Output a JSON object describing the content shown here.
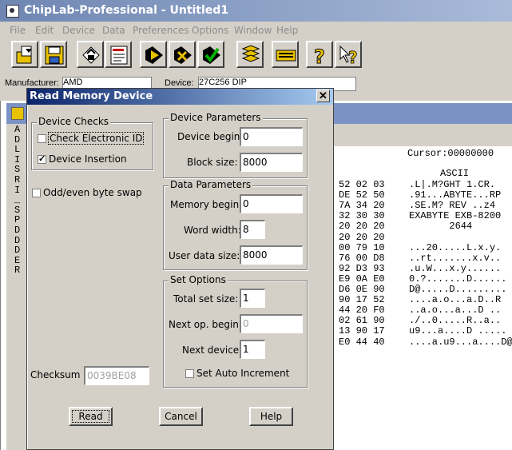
{
  "app": {
    "title": "ChipLab-Professional - Untitled1"
  },
  "menu": [
    "File",
    "Edit",
    "Device",
    "Data",
    "Preferences",
    "Options",
    "Window",
    "Help"
  ],
  "toolbar": {
    "buttons": [
      "open-icon",
      "save-icon",
      "read-device-icon",
      "note-icon",
      "program-icon",
      "verify-icon",
      "blank-check-icon",
      "layers-icon",
      "keyboard-icon",
      "help-icon",
      "context-help-icon"
    ]
  },
  "device_bar": {
    "manufacturer_label": "Manufacturer:",
    "manufacturer_value": "AMD",
    "device_label": "Device:",
    "device_value": "27C256 DIP"
  },
  "child": {
    "left_letters": [
      "A",
      "D",
      "L",
      "I",
      "S",
      "R",
      "I",
      "_",
      "S",
      "P",
      "D",
      "D",
      "D",
      "E",
      "R"
    ],
    "cursor_label": "Cursor:00000000",
    "ascii_header": "ASCII",
    "hex_rows": [
      {
        "hex": "52 02 03",
        "ascii": ".L|.M?GHT 1.CR."
      },
      {
        "hex": "DE 52 50",
        "ascii": ".91...ABYTE...RP"
      },
      {
        "hex": "7A 34 20",
        "ascii": ".SE.M? REV ..z4"
      },
      {
        "hex": "32 30 30",
        "ascii": "EXABYTE EXB-8200"
      },
      {
        "hex": "20 20 20",
        "ascii": "       2644"
      },
      {
        "hex": "20 20 20",
        "ascii": ""
      },
      {
        "hex": "00 79 10",
        "ascii": "...20.....L.x.y."
      },
      {
        "hex": "76 00 D8",
        "ascii": "..rt.......x.v.."
      },
      {
        "hex": "92 D3 93",
        "ascii": ".u.W...x.y......"
      },
      {
        "hex": "E9 0A E0",
        "ascii": "0.?.......D......"
      },
      {
        "hex": "D6 0E 90",
        "ascii": "D@.....D........."
      },
      {
        "hex": "90 17 52",
        "ascii": "....a.o...a.D..R"
      },
      {
        "hex": "44 20 F0",
        "ascii": "..a.o...a...D .."
      },
      {
        "hex": "02 61 90",
        "ascii": "./..0.....R..a.."
      },
      {
        "hex": "13 90 17",
        "ascii": "u9...a....D ....."
      },
      {
        "hex": "E0 44 40",
        "ascii": "....a.u9...a....D@"
      }
    ]
  },
  "dialog": {
    "title": "Read Memory Device",
    "device_checks": {
      "title": "Device Checks",
      "check_electronic_id": {
        "label": "Check Electronic ID",
        "checked": false
      },
      "device_insertion": {
        "label": "Device Insertion",
        "checked": true
      }
    },
    "odd_even_swap": {
      "label": "Odd/even byte swap",
      "checked": false
    },
    "device_parameters": {
      "title": "Device Parameters",
      "device_begin_label": "Device begin:",
      "device_begin": "0",
      "block_size_label": "Block size:",
      "block_size": "8000"
    },
    "data_parameters": {
      "title": "Data Parameters",
      "memory_begin_label": "Memory begin:",
      "memory_begin": "0",
      "word_width_label": "Word width:",
      "word_width": "8",
      "user_data_size_label": "User data size:",
      "user_data_size": "8000"
    },
    "set_options": {
      "title": "Set Options",
      "total_set_size_label": "Total set size:",
      "total_set_size": "1",
      "next_op_begin_label": "Next op. begin:",
      "next_op_begin": "0",
      "next_device_label": "Next device:",
      "next_device": "1",
      "set_auto_increment": {
        "label": "Set Auto Increment",
        "checked": false
      }
    },
    "checksum_label": "Checksum",
    "checksum_value": "0039BE08",
    "buttons": {
      "read": "Read",
      "cancel": "Cancel",
      "help": "Help"
    }
  }
}
